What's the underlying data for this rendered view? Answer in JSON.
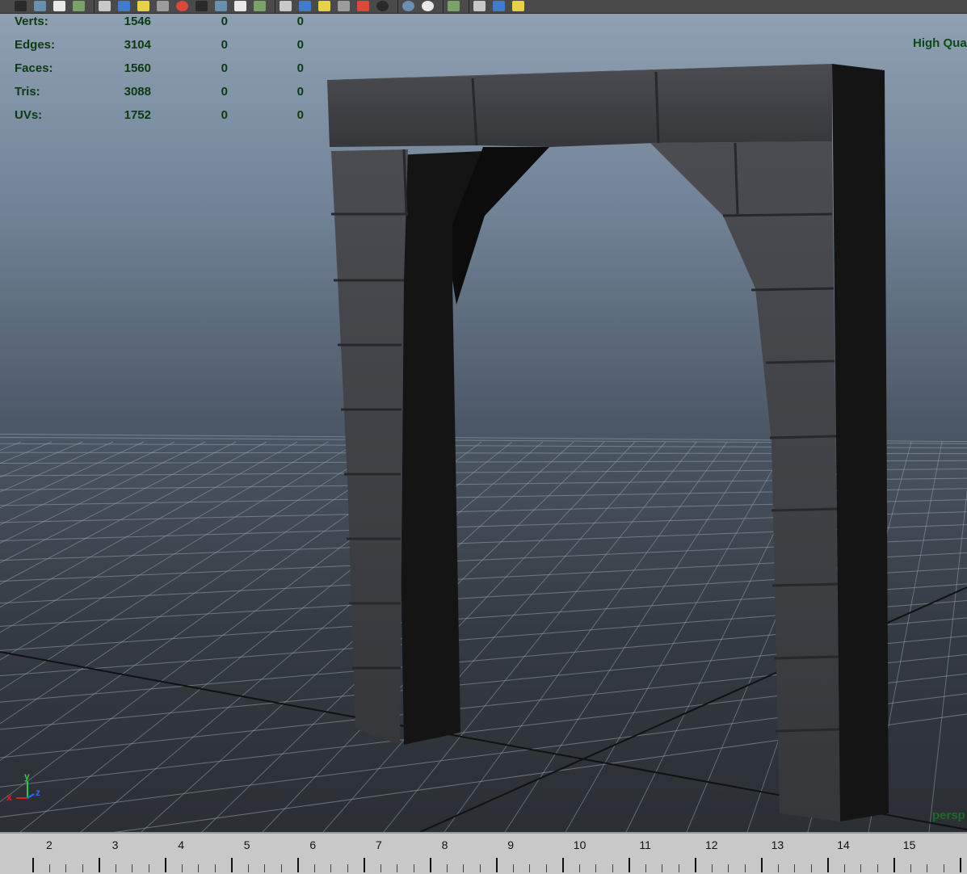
{
  "toolbar": {
    "icons": [
      "camera-icon",
      "script-icon",
      "render-icon",
      "layers-icon",
      "paint-icon",
      "wireframe-icon",
      "shaded-icon",
      "grid-icon",
      "sphere-icon",
      "light-icon",
      "xray-icon",
      "joint-icon",
      "isolate-icon",
      "texture-icon",
      "cube-icon",
      "cube-blue-icon",
      "cube-select-icon",
      "hypershade-icon",
      "light-bulb-icon",
      "sphere-gray-icon",
      "sphere-dark-icon",
      "cursor-icon",
      "camera-view-icon",
      "copy-icon",
      "snap-icon"
    ]
  },
  "hud": {
    "rows": [
      {
        "label": "Verts:",
        "a": "1546",
        "b": "0",
        "c": "0"
      },
      {
        "label": "Edges:",
        "a": "3104",
        "b": "0",
        "c": "0"
      },
      {
        "label": "Faces:",
        "a": "1560",
        "b": "0",
        "c": "0"
      },
      {
        "label": "Tris:",
        "a": "3088",
        "b": "0",
        "c": "0"
      },
      {
        "label": "UVs:",
        "a": "1752",
        "b": "0",
        "c": "0"
      }
    ],
    "quality": "High Qua",
    "camera": "persp"
  },
  "axis": {
    "x": "x",
    "y": "y",
    "z": "z"
  },
  "timeline": {
    "labels": [
      "2",
      "3",
      "4",
      "5",
      "6",
      "7",
      "8",
      "9",
      "10",
      "11",
      "12",
      "13",
      "14",
      "15"
    ]
  },
  "colors": {
    "hud_text": "#0d3a12",
    "stone": "#3d3f44",
    "grid": "#9aa4ae"
  }
}
